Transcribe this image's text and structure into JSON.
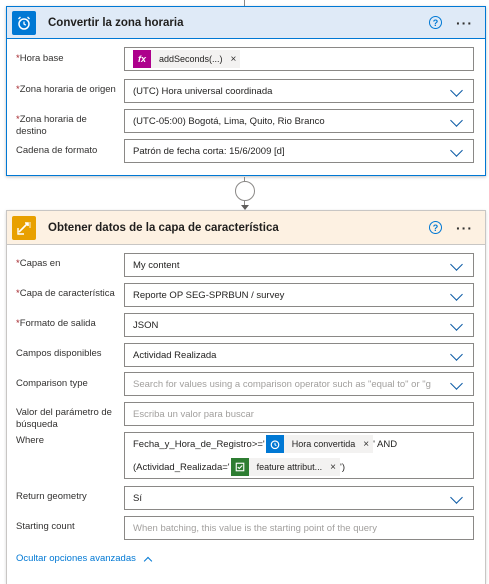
{
  "card1": {
    "title": "Convertir la zona horaria",
    "help_icon": "question-circle-icon",
    "more_label": "···",
    "fields": [
      {
        "label": "Hora base",
        "required": true,
        "token": {
          "icon": "fx-icon",
          "icon_text": "fx",
          "text": "addSeconds(...)",
          "remove": "×",
          "color": "#ad008c"
        }
      },
      {
        "label": "Zona horaria de origen",
        "required": true,
        "value": "(UTC) Hora universal coordinada"
      },
      {
        "label": "Zona horaria de destino",
        "required": true,
        "value": "(UTC-05:00) Bogotá, Lima, Quito, Rio Branco"
      },
      {
        "label": "Cadena de formato",
        "required": false,
        "value": "Patrón de fecha corta: 15/6/2009 [d]"
      }
    ]
  },
  "card2": {
    "title": "Obtener datos de la capa de característica",
    "help_icon": "question-circle-icon",
    "more_label": "···",
    "fields": [
      {
        "label": "Capas en",
        "required": true,
        "value": "My content"
      },
      {
        "label": "Capa de característica",
        "required": true,
        "value": "Reporte OP SEG-SPRBUN / survey"
      },
      {
        "label": "Formato de salida",
        "required": true,
        "value": "JSON"
      },
      {
        "label": "Campos disponibles",
        "required": false,
        "value": "Actividad Realizada"
      },
      {
        "label": "Comparison type",
        "required": false,
        "placeholder": "Search for values using a comparison operator such as \"equal to\" or \"g"
      },
      {
        "label": "Valor del parámetro de búsqueda",
        "required": false,
        "placeholder": "Escriba un valor para buscar"
      },
      {
        "label": "Where",
        "required": false
      },
      {
        "label": "Return geometry",
        "required": false,
        "value": "Sí"
      },
      {
        "label": "Starting count",
        "required": false,
        "placeholder": "When batching, this value is the starting point of the query"
      }
    ],
    "where": {
      "line1_prefix": "Fecha_y_Hora_de_Registro>='",
      "line1_token": {
        "text": "Hora convertida",
        "remove": "×",
        "color": "#0078d4",
        "icon": "alarm-clock-icon"
      },
      "line1_suffix": "' AND",
      "line2_prefix": "(Actividad_Realizada='",
      "line2_token": {
        "text": "feature attribut...",
        "remove": "×",
        "color": "#2e7d32",
        "icon": "survey-icon"
      },
      "line2_suffix": "')"
    },
    "advanced_link": "Ocultar opciones avanzadas"
  },
  "colors": {
    "accent": "#0078d4",
    "required": "#a4262c",
    "card2_header": "#fdf1e2",
    "card1_header": "#dfeaf7"
  }
}
